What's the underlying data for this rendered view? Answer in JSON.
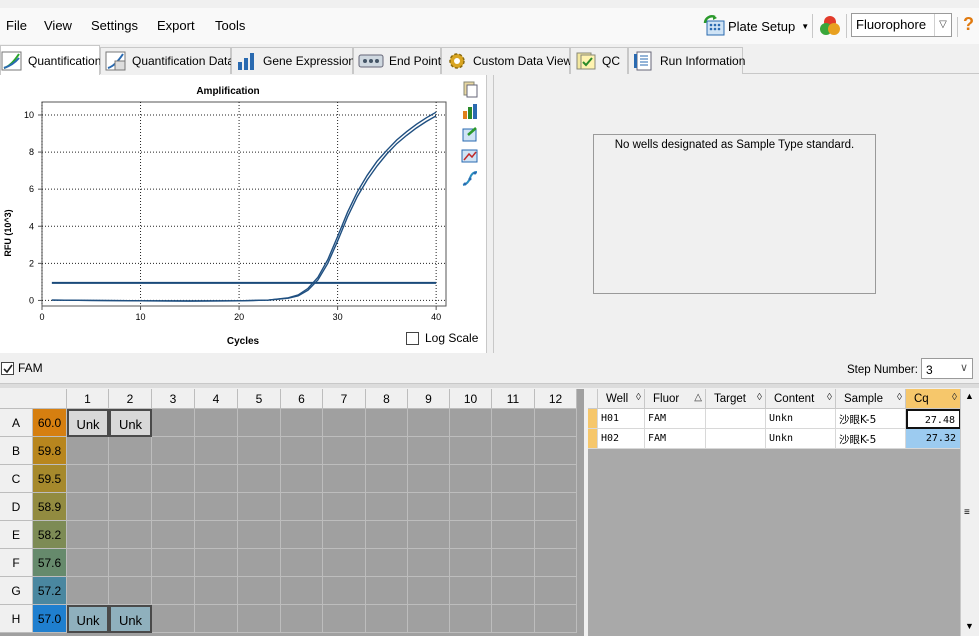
{
  "menu": {
    "file": "File",
    "view": "View",
    "settings": "Settings",
    "export": "Export",
    "tools": "Tools"
  },
  "toolbar": {
    "plate_setup": "Plate Setup",
    "fluorophore": "Fluorophore",
    "help": "?"
  },
  "tabs": [
    "Quantification",
    "Quantification Data",
    "Gene Expression",
    "End Point",
    "Custom Data View",
    "QC",
    "Run Information"
  ],
  "chart_data": {
    "type": "line",
    "title": "Amplification",
    "xlabel": "Cycles",
    "ylabel": "RFU (10^3)",
    "xlim": [
      0,
      41
    ],
    "ylim": [
      -0.3,
      10.7
    ],
    "xticks": [
      0,
      10,
      20,
      30,
      40
    ],
    "yticks": [
      0,
      2,
      4,
      6,
      8,
      10
    ],
    "grid": true,
    "threshold": 0.95,
    "series": [
      {
        "values": [
          [
            1,
            0.02
          ],
          [
            5,
            0.0
          ],
          [
            10,
            -0.02
          ],
          [
            15,
            -0.03
          ],
          [
            20,
            -0.02
          ],
          [
            23,
            0.02
          ],
          [
            25,
            0.12
          ],
          [
            26,
            0.25
          ],
          [
            27,
            0.55
          ],
          [
            28,
            1.1
          ],
          [
            29,
            2.0
          ],
          [
            30,
            3.2
          ],
          [
            31,
            4.5
          ],
          [
            32,
            5.6
          ],
          [
            33,
            6.5
          ],
          [
            34,
            7.25
          ],
          [
            35,
            7.9
          ],
          [
            36,
            8.45
          ],
          [
            37,
            8.9
          ],
          [
            38,
            9.3
          ],
          [
            39,
            9.65
          ],
          [
            40,
            9.95
          ]
        ]
      },
      {
        "values": [
          [
            1,
            0.02
          ],
          [
            5,
            0.0
          ],
          [
            10,
            -0.02
          ],
          [
            15,
            -0.03
          ],
          [
            20,
            -0.02
          ],
          [
            23,
            0.02
          ],
          [
            25,
            0.14
          ],
          [
            26,
            0.3
          ],
          [
            27,
            0.65
          ],
          [
            28,
            1.25
          ],
          [
            29,
            2.2
          ],
          [
            30,
            3.45
          ],
          [
            31,
            4.75
          ],
          [
            32,
            5.85
          ],
          [
            33,
            6.75
          ],
          [
            34,
            7.5
          ],
          [
            35,
            8.1
          ],
          [
            36,
            8.65
          ],
          [
            37,
            9.1
          ],
          [
            38,
            9.5
          ],
          [
            39,
            9.85
          ],
          [
            40,
            10.15
          ]
        ]
      }
    ]
  },
  "log_scale": "Log Scale",
  "std_message": "No wells designated as Sample Type standard.",
  "fam_label": "FAM",
  "step_label": "Step Number:",
  "step_value": "3",
  "plate": {
    "cols": [
      "1",
      "2",
      "3",
      "4",
      "5",
      "6",
      "7",
      "8",
      "9",
      "10",
      "11",
      "12"
    ],
    "rows": [
      {
        "label": "A",
        "temp": "60.0",
        "c1": "Unk",
        "c2": "Unk"
      },
      {
        "label": "B",
        "temp": "59.8",
        "c1": "",
        "c2": ""
      },
      {
        "label": "C",
        "temp": "59.5",
        "c1": "",
        "c2": ""
      },
      {
        "label": "D",
        "temp": "58.9",
        "c1": "",
        "c2": ""
      },
      {
        "label": "E",
        "temp": "58.2",
        "c1": "",
        "c2": ""
      },
      {
        "label": "F",
        "temp": "57.6",
        "c1": "",
        "c2": ""
      },
      {
        "label": "G",
        "temp": "57.2",
        "c1": "",
        "c2": ""
      },
      {
        "label": "H",
        "temp": "57.0",
        "c1": "Unk",
        "c2": "Unk"
      }
    ],
    "temp_colors": [
      "#d67f10",
      "#b8861e",
      "#a6892c",
      "#928b40",
      "#7d8b55",
      "#668a6c",
      "#4a87a0",
      "#1f7fcf"
    ]
  },
  "wells": {
    "headers": [
      "Well",
      "Fluor",
      "Target",
      "Content",
      "Sample",
      "Cq"
    ],
    "sort_icons": [
      "◊",
      "△",
      "◊",
      "◊",
      "◊",
      "◊"
    ],
    "rows": [
      {
        "well": "H01",
        "fluor": "FAM",
        "target": "",
        "content": "Unkn",
        "sample": "沙眼K-5",
        "cq": "27.48"
      },
      {
        "well": "H02",
        "fluor": "FAM",
        "target": "",
        "content": "Unkn",
        "sample": "沙眼K-5",
        "cq": "27.32"
      }
    ]
  }
}
